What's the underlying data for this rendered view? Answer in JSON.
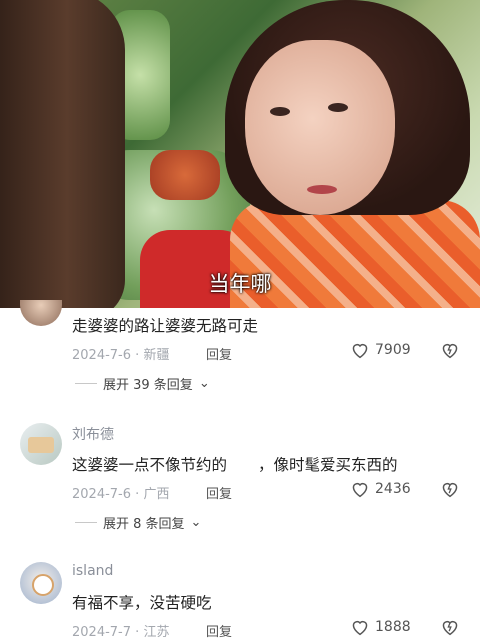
{
  "video": {
    "subtitle": "当年哪"
  },
  "comments": [
    {
      "text": "走婆婆的路让婆婆无路可走",
      "date": "2024-7-6",
      "location": "新疆",
      "reply_label": "回复",
      "likes": "7909",
      "expand_label": "展开 39 条回复"
    },
    {
      "username": "刘布德",
      "text": "这婆婆一点不像节约的　　，像时髦爱买东西的",
      "date": "2024-7-6",
      "location": "广西",
      "reply_label": "回复",
      "likes": "2436",
      "expand_label": "展开 8 条回复"
    },
    {
      "username": "island",
      "text": "有福不享，没苦硬吃",
      "date": "2024-7-7",
      "location": "江苏",
      "reply_label": "回复",
      "likes": "1888"
    }
  ],
  "colors": {
    "meta": "#a3a7ae",
    "text": "#222222",
    "username": "#8a8f99"
  }
}
